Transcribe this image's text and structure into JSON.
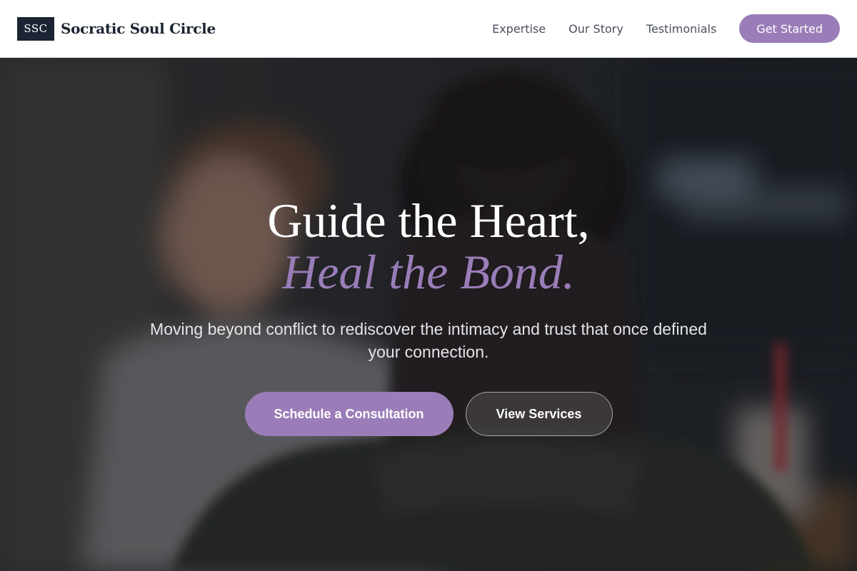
{
  "header": {
    "logo_mark": "SSC",
    "brand_name": "Socratic Soul Circle",
    "nav": [
      "Expertise",
      "Our Story",
      "Testimonials"
    ],
    "cta_label": "Get Started"
  },
  "hero": {
    "headline": "Guide the Heart,",
    "headline_accent": "Heal the Bond.",
    "subtext": "Moving beyond conflict to rediscover the intimacy and trust that once defined your connection.",
    "primary_button": "Schedule a Consultation",
    "secondary_button": "View Services"
  },
  "colors": {
    "accent": "#9a7db8",
    "navy": "#1c2433",
    "nav_text": "#4a4f5a"
  }
}
